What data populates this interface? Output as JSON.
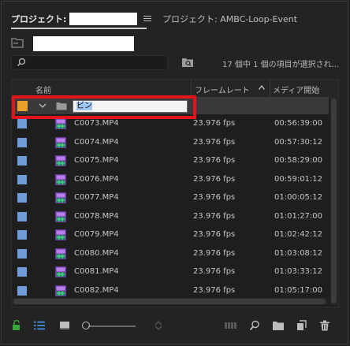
{
  "tabs": {
    "active_label": "プロジェクト:",
    "inactive_label": "プロジェクト: AMBC-Loop-Event"
  },
  "search": {
    "value": "",
    "placeholder": ""
  },
  "status": {
    "selection_text": "17 個中 1 個の項目が選択され..."
  },
  "columns": {
    "name": "名前",
    "frame_rate": "フレームレート",
    "media_start": "メディア開始"
  },
  "bin": {
    "name_value": "ビン",
    "label_color": "#e8a12b"
  },
  "clip_label_color": "#6f9bd8",
  "rows": [
    {
      "name": "C0073.MP4",
      "fps": "23.976 fps",
      "start": "00:56:39:00"
    },
    {
      "name": "C0074.MP4",
      "fps": "23.976 fps",
      "start": "00:57:30:12"
    },
    {
      "name": "C0075.MP4",
      "fps": "23.976 fps",
      "start": "00:58:29:00"
    },
    {
      "name": "C0076.MP4",
      "fps": "23.976 fps",
      "start": "00:59:01:12"
    },
    {
      "name": "C0077.MP4",
      "fps": "23.976 fps",
      "start": "01:00:05:12"
    },
    {
      "name": "C0078.MP4",
      "fps": "23.976 fps",
      "start": "01:01:27:00"
    },
    {
      "name": "C0079.MP4",
      "fps": "23.976 fps",
      "start": "01:02:42:12"
    },
    {
      "name": "C0080.MP4",
      "fps": "23.976 fps",
      "start": "01:03:08:12"
    },
    {
      "name": "C0081.MP4",
      "fps": "23.976 fps",
      "start": "01:03:33:12"
    },
    {
      "name": "C0082.MP4",
      "fps": "23.976 fps",
      "start": "01:05:17:00"
    }
  ],
  "toolbar_icons": [
    "lock-icon",
    "list-view-icon",
    "icon-view-icon",
    "zoom-slider",
    "sort-icon",
    "automate-to-sequence-icon",
    "find-icon",
    "new-bin-icon",
    "new-item-icon",
    "trash-icon"
  ]
}
